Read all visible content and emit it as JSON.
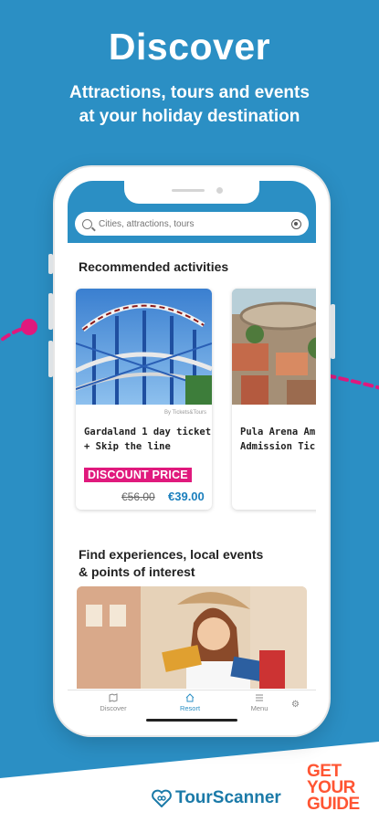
{
  "header": {
    "title": "Discover",
    "subtitle_line1": "Attractions, tours and events",
    "subtitle_line2": "at your holiday destination"
  },
  "search": {
    "placeholder": "Cities, attractions, tours",
    "search_icon": "search-icon",
    "locate_icon": "locate-icon"
  },
  "sections": {
    "recommended": "Recommended activities",
    "find_line1": "Find experiences, local events",
    "find_line2": "& points of interest"
  },
  "cards": [
    {
      "provider": "By Tickets&Tours",
      "title_line1": "Gardaland 1 day ticket",
      "title_line2": "+ Skip the line",
      "badge": "DISCOUNT PRICE",
      "old_price": "€56.00",
      "new_price": "€39.00"
    },
    {
      "title_line1": "Pula Arena Am",
      "title_line2": "Admission Tick"
    }
  ],
  "tabbar": {
    "items": [
      {
        "label": "Discover",
        "icon": "map-icon"
      },
      {
        "label": "Resort",
        "icon": "home-icon"
      },
      {
        "label": "Menu",
        "icon": "menu-icon"
      }
    ],
    "settings_icon": "gear-icon",
    "active": "Resort"
  },
  "brands": {
    "tourscanner": "TourScanner",
    "getyourguide_line1": "GET",
    "getyourguide_line2": "YOUR",
    "getyourguide_line3": "GUIDE"
  },
  "colors": {
    "background": "#2b8fc4",
    "accent_pink": "#e0197d",
    "price_blue": "#1b7fbd",
    "gyg_orange": "#ff5533"
  }
}
